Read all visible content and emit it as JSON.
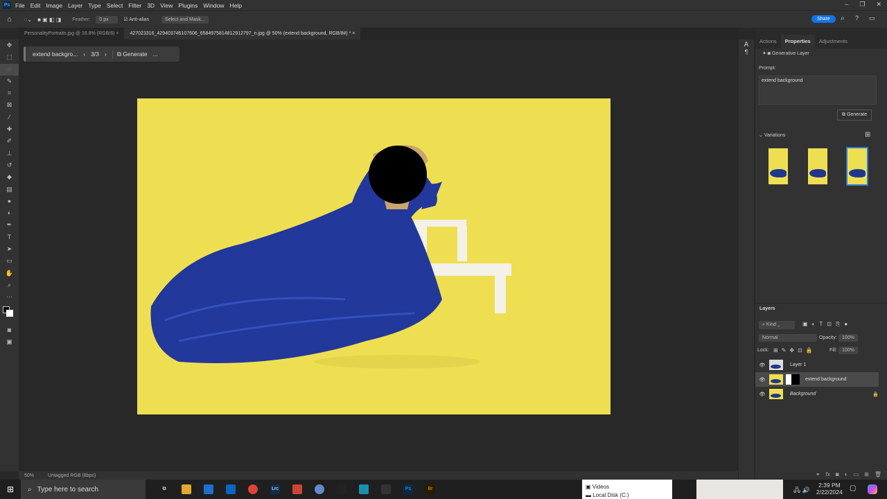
{
  "app": {
    "logo": "Ps",
    "menu": [
      "File",
      "Edit",
      "Image",
      "Layer",
      "Type",
      "Select",
      "Filter",
      "3D",
      "View",
      "Plugins",
      "Window",
      "Help"
    ],
    "share": "Share"
  },
  "options": {
    "feather_label": "Feather:",
    "feather_value": "0 px",
    "antialias": "Anti-alias",
    "select_mask": "Select and Mask..."
  },
  "tabs": [
    {
      "label": "PersonalityPortraits.jpg @ 16.8% (RGB/8)"
    },
    {
      "label": "427023316_429403746107606_6584975814812912797_n.jpg @ 50% (extend background, RGB/8#) *"
    }
  ],
  "contextbar": {
    "prompt": "extend backgro...",
    "counter": "3/3",
    "generate": "Generate",
    "more": "..."
  },
  "status": {
    "zoom": "50%",
    "profile": "Untagged RGB (8bpc)"
  },
  "properties": {
    "tabs": [
      "Actions",
      "Properties",
      "Adjustments"
    ],
    "layer_type": "Generative Layer",
    "prompt_label": "Prompt:",
    "prompt_value": "extend background",
    "generate": "Generate",
    "variations": "Variations"
  },
  "layers": {
    "title": "Layers",
    "kind": "Kind",
    "blend": "Normal",
    "opacity_label": "Opacity:",
    "opacity": "100%",
    "lock_label": "Lock:",
    "fill_label": "Fill:",
    "fill": "100%",
    "items": [
      {
        "name": "Layer 1"
      },
      {
        "name": "extend background"
      },
      {
        "name": "Background"
      }
    ]
  },
  "taskbar": {
    "search_placeholder": "Type here to search",
    "explorer_items": [
      "Videos",
      "Local Disk (C:)"
    ],
    "time": "2:39 PM",
    "date": "2/22/2024"
  }
}
